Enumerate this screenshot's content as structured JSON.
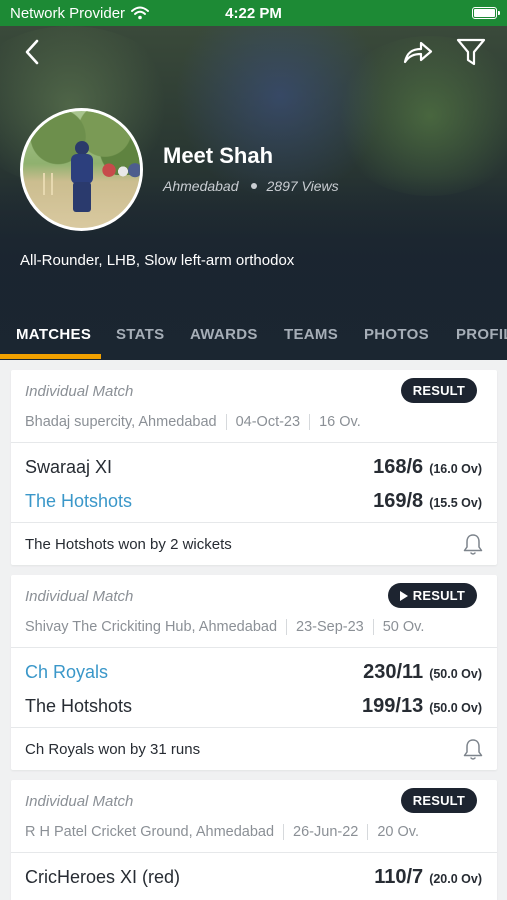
{
  "status_bar": {
    "carrier": "Network Provider",
    "time": "4:22 PM"
  },
  "profile": {
    "name": "Meet Shah",
    "city": "Ahmedabad",
    "views": "2897 Views",
    "role": "All-Rounder, LHB, Slow left-arm orthodox"
  },
  "tabs": [
    {
      "label": "MATCHES",
      "active": true
    },
    {
      "label": "STATS",
      "active": false
    },
    {
      "label": "AWARDS",
      "active": false
    },
    {
      "label": "TEAMS",
      "active": false
    },
    {
      "label": "PHOTOS",
      "active": false
    },
    {
      "label": "PROFIL",
      "active": false
    }
  ],
  "matches": [
    {
      "type": "Individual Match",
      "status": "RESULT",
      "venue": "Bhadaj supercity, Ahmedabad",
      "date": "04-Oct-23",
      "overs_limit": "16 Ov.",
      "team1": {
        "name": "Swaraaj XI",
        "score": "168/6",
        "overs": "(16.0 Ov)"
      },
      "team2": {
        "name": "The Hotshots",
        "score": "169/8",
        "overs": "(15.5 Ov)"
      },
      "summary": "The Hotshots won by 2 wickets"
    },
    {
      "type": "Individual Match",
      "status": "RESULT",
      "venue": "Shivay The Crickiting Hub, Ahmedabad",
      "date": "23-Sep-23",
      "overs_limit": "50 Ov.",
      "team1": {
        "name": "Ch Royals",
        "score": "230/11",
        "overs": "(50.0 Ov)"
      },
      "team2": {
        "name": "The Hotshots",
        "score": "199/13",
        "overs": "(50.0 Ov)"
      },
      "summary": "Ch Royals won by 31 runs"
    },
    {
      "type": "Individual Match",
      "status": "RESULT",
      "venue": "R H Patel Cricket Ground, Ahmedabad",
      "date": "26-Jun-22",
      "overs_limit": "20 Ov.",
      "team1": {
        "name": "CricHeroes XI (red)",
        "score": "110/7",
        "overs": "(20.0 Ov)"
      }
    }
  ],
  "icons": {
    "back": "chevron-left-icon",
    "share": "share-arrow-icon",
    "filter": "filter-funnel-icon",
    "notify": "bell-icon",
    "wifi": "wifi-icon",
    "battery": "battery-icon"
  },
  "colors": {
    "status_bar": "#1d8a35",
    "tab_indicator": "#f2a100",
    "winner_team": "#3a97c9",
    "result_badge": "#1d2430"
  }
}
